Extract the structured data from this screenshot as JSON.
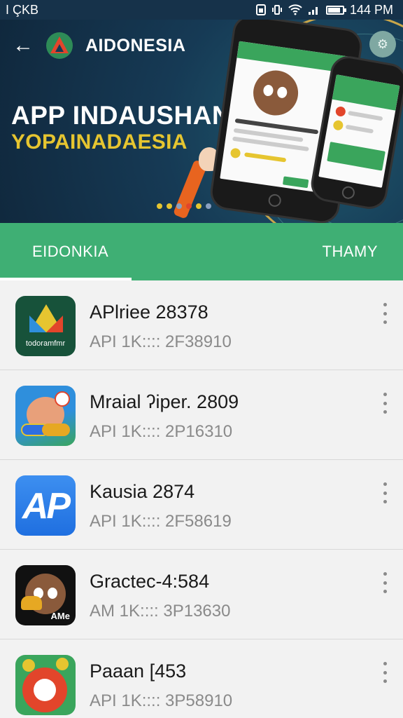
{
  "status_bar": {
    "left_text": "I ÇKB",
    "time": "144 PM",
    "battery_level": 0.85
  },
  "header": {
    "app_name": "AIDONESIA"
  },
  "hero": {
    "title": "APP INDAUSHAN",
    "subtitle": "YOPAINADAESIA",
    "carousel_dot_colors": [
      "#e6c530",
      "#e6c530",
      "#8aa0c0",
      "#e2452b",
      "#e6c530",
      "#8aa0c0"
    ]
  },
  "tabs": [
    {
      "label": "EIDONKIA",
      "selected": true
    },
    {
      "label": "THAMY",
      "selected": false
    }
  ],
  "apps": [
    {
      "title": "APlriee 28378",
      "subtitle": "API 1K:::: 2F38910",
      "icon": "ic1",
      "icon_caption": "todoramfmr"
    },
    {
      "title": "Mraial ʔiper. 2809",
      "subtitle": "API 1K:::: 2P16310",
      "icon": "ic2",
      "icon_caption": ""
    },
    {
      "title": "Kausia 2874",
      "subtitle": "API 1K:::: 2F58619",
      "icon": "ic3",
      "icon_caption": "AP"
    },
    {
      "title": "Gractec-4:584",
      "subtitle": "AM 1K:::: 3P13630",
      "icon": "ic4",
      "icon_caption": "AMe"
    },
    {
      "title": "Paaan [453",
      "subtitle": "API 1K:::: 3P58910",
      "icon": "ic5",
      "icon_caption": ""
    }
  ],
  "colors": {
    "accent_green": "#3faf74",
    "hero_bg": "#163a55",
    "hero_subtitle": "#e6c530"
  },
  "icons": {
    "back": "back-arrow-icon",
    "settings": "settings-icon",
    "more": "more-vert-icon"
  }
}
